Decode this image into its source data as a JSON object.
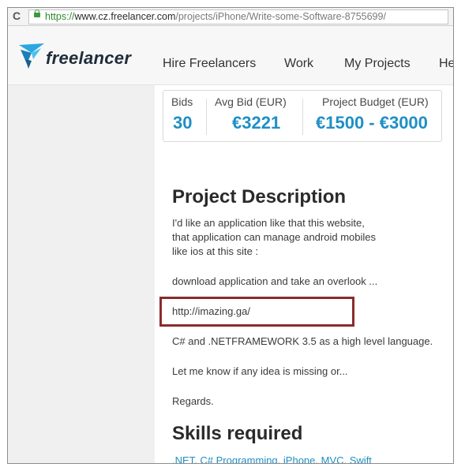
{
  "browser": {
    "url_scheme": "https://",
    "url_host": "www.cz.freelancer.com",
    "url_path": "/projects/iPhone/Write-some-Software-8755699/"
  },
  "header": {
    "logo_text": "freelancer",
    "nav": [
      {
        "label": "Hire Freelancers"
      },
      {
        "label": "Work"
      },
      {
        "label": "My Projects"
      },
      {
        "label": "He"
      }
    ]
  },
  "stats": {
    "bids_label": "Bids",
    "bids_value": "30",
    "avg_label": "Avg Bid (EUR)",
    "avg_value": "€3221",
    "budget_label": "Project Budget (EUR)",
    "budget_value": "€1500 - €3000"
  },
  "project": {
    "heading": "Project Description",
    "lines": [
      "I'd like an application like that this website,",
      "that application can manage android mobiles",
      "like ios at this site :"
    ],
    "download_line": "download application and take an overlook ...",
    "link": "http://imazing.ga/",
    "tech_line": "C# and .NETFRAMEWORK 3.5 as a high level language.",
    "missing_line": "Let me know if any idea is missing or...",
    "regards": "Regards.",
    "skills_heading": "Skills required",
    "skills": [
      ".NET",
      "C# Programming",
      "iPhone",
      "MVC",
      "Swift"
    ]
  },
  "colors": {
    "accent": "#1f8fc4",
    "highlight_border": "#8b2b2b"
  }
}
